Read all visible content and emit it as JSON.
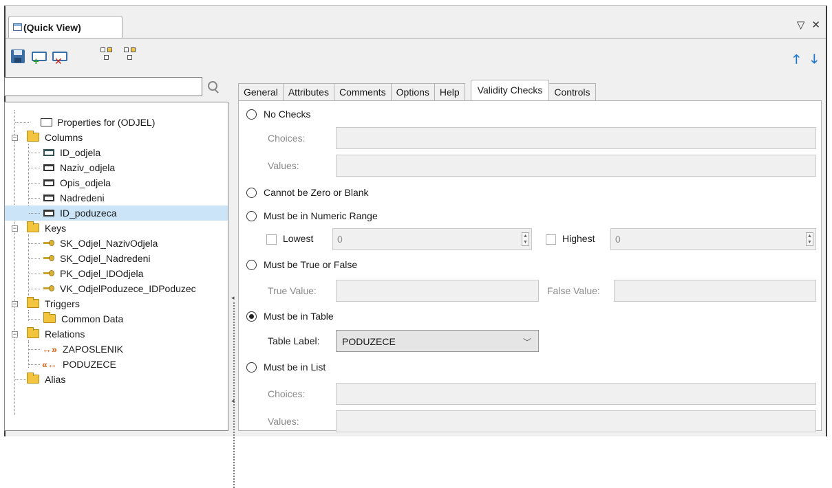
{
  "window": {
    "title": "(Quick View)",
    "controls": [
      "▽",
      "✕"
    ]
  },
  "toolbar": {
    "up_arrow": "🡑",
    "down_arrow": "🡓"
  },
  "search": {
    "placeholder": ""
  },
  "tree": {
    "properties": "Properties for (ODJEL)",
    "columns": {
      "label": "Columns",
      "items": [
        "ID_odjela",
        "Naziv_odjela",
        "Opis_odjela",
        "Nadredeni",
        "ID_poduzeca"
      ]
    },
    "keys": {
      "label": "Keys",
      "items": [
        "SK_Odjel_NazivOdjela",
        "SK_Odjel_Nadredeni",
        "PK_Odjel_IDOdjela",
        "VK_OdjelPoduzece_IDPoduzec"
      ]
    },
    "triggers": {
      "label": "Triggers",
      "items": [
        "Common Data"
      ]
    },
    "relations": {
      "label": "Relations",
      "items": [
        "ZAPOSLENIK",
        "PODUZECE"
      ]
    },
    "alias": "Alias"
  },
  "tabs": [
    "General",
    "Attributes",
    "Comments",
    "Options",
    "Help",
    "Validity Checks",
    "Controls"
  ],
  "active_tab": "Validity Checks",
  "validity": {
    "no_checks": "No Checks",
    "choices_label": "Choices:",
    "values_label": "Values:",
    "not_zero": "Cannot be Zero or Blank",
    "numeric_range": "Must be in Numeric Range",
    "lowest_label": "Lowest",
    "lowest_value": "0",
    "highest_label": "Highest",
    "highest_value": "0",
    "true_false": "Must be True or False",
    "true_value_label": "True Value:",
    "false_value_label": "False Value:",
    "in_table": "Must be in Table",
    "table_label": "Table Label:",
    "table_value": "PODUZECE",
    "in_list": "Must be in List",
    "list_choices_label": "Choices:",
    "list_values_label": "Values:",
    "selected_option": "Must be in Table"
  },
  "colors": {
    "selection": "#cce4f7",
    "relation": "#e06010",
    "arrow": "#1f77d0"
  }
}
